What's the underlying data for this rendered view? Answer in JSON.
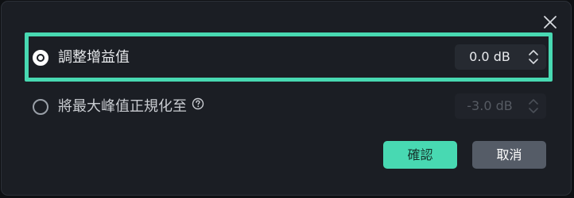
{
  "dialog": {
    "close_icon": "close-icon",
    "options": [
      {
        "label": "調整增益值",
        "selected": true,
        "value": "0.0 dB",
        "enabled": true
      },
      {
        "label": "將最大峰值正規化至",
        "selected": false,
        "value": "-3.0 dB",
        "enabled": false,
        "help_icon": "help-icon"
      }
    ],
    "buttons": {
      "confirm_label": "確認",
      "cancel_label": "取消"
    }
  },
  "colors": {
    "accent": "#48d9b2",
    "dialog_bg": "#1b1e24",
    "cancel_bg": "#555c67",
    "text": "#e8eaed"
  }
}
